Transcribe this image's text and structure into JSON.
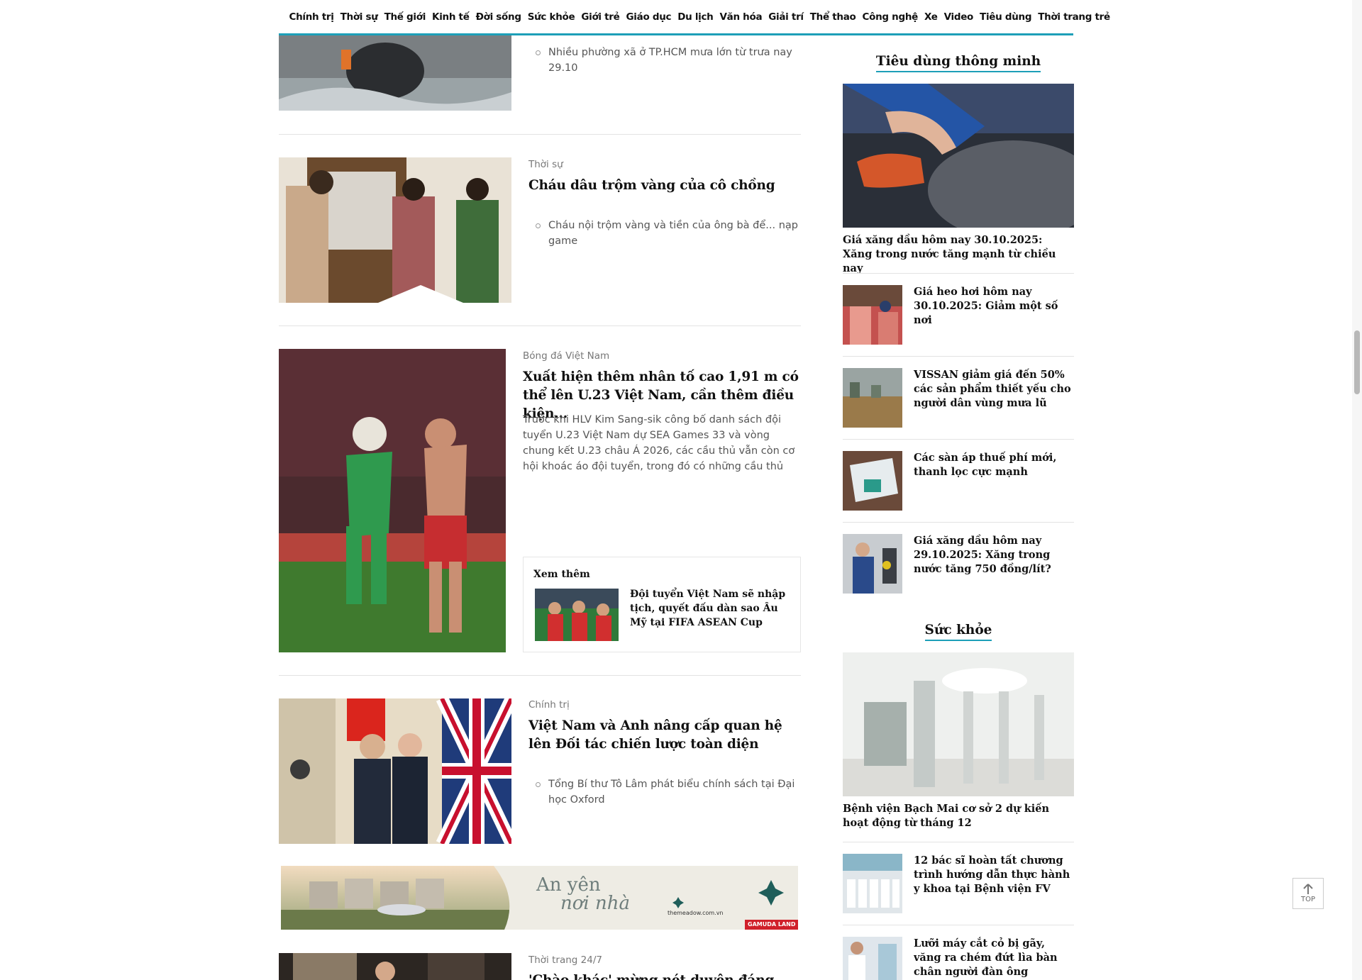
{
  "nav": {
    "items": [
      "Chính trị",
      "Thời sự",
      "Thế giới",
      "Kinh tế",
      "Đời sống",
      "Sức khỏe",
      "Giới trẻ",
      "Giáo dục",
      "Du lịch",
      "Văn hóa",
      "Giải trí",
      "Thể thao",
      "Công nghệ",
      "Xe",
      "Video",
      "Tiêu dùng",
      "Thời trang trẻ"
    ]
  },
  "articles": [
    {
      "bullet": "Nhiều phường xã ở TP.HCM mưa lớn từ trưa nay 29.10"
    },
    {
      "category": "Thời sự",
      "title": "Cháu dâu trộm vàng của cô chồng",
      "bullet": "Cháu nội trộm vàng và tiền của ông bà để... nạp game"
    },
    {
      "category": "Bóng đá Việt Nam",
      "title": "Xuất hiện thêm nhân tố cao 1,91 m có thể lên U.23 Việt Nam, cần thêm điều kiện...",
      "summary": "Trước khi HLV Kim Sang-sik công bố danh sách đội tuyển U.23 Việt Nam dự SEA Games 33 và vòng chung kết U.23 châu Á 2026, các cầu thủ vẫn còn cơ hội khoác áo đội tuyển, trong đó có những cầu thủ Việt",
      "see_more_label": "Xem thêm",
      "see_more_title": "Đội tuyển Việt Nam sẽ nhập tịch, quyết đấu dàn sao Âu Mỹ tại FIFA ASEAN Cup"
    },
    {
      "category": "Chính trị",
      "title": "Việt Nam và Anh nâng cấp quan hệ lên Đối tác chiến lược toàn diện",
      "bullet": "Tổng Bí thư Tô Lâm phát biểu chính sách tại Đại học Oxford"
    },
    {
      "category": "Thời trang 24/7",
      "title": "'Chào khác' mừng nét duyên đáng, thanh lịch"
    }
  ],
  "ad": {
    "line1": "An yên",
    "line2": "nơi nhà",
    "site": "themeadow.com.vn",
    "brand": "GAMUDA LAND"
  },
  "sidebar": {
    "section1": {
      "title": "Tiêu dùng thông minh",
      "big_caption": "Giá xăng dầu hôm nay 30.10.2025: Xăng trong nước tăng mạnh từ chiều nay",
      "items": [
        "Giá heo hơi hôm nay 30.10.2025: Giảm một số nơi",
        "VISSAN giảm giá đến 50% các sản phẩm thiết yếu cho người dân vùng mưa lũ",
        "Các sàn áp thuế phí mới, thanh lọc cực mạnh",
        "Giá xăng dầu hôm nay 29.10.2025: Xăng trong nước tăng 750 đồng/lít?"
      ]
    },
    "section2": {
      "title": "Sức khỏe",
      "big_caption": "Bệnh viện Bạch Mai cơ sở 2 dự kiến hoạt động từ tháng 12",
      "items": [
        "12 bác sĩ hoàn tất chương trình hướng dẫn thực hành y khoa tại Bệnh viện FV",
        "Lưỡi máy cắt cỏ bị gãy, văng ra chém đứt lìa bàn chân người đàn ông"
      ]
    }
  },
  "top_button": "TOP",
  "colors": {
    "accent": "#1d9fb8"
  }
}
